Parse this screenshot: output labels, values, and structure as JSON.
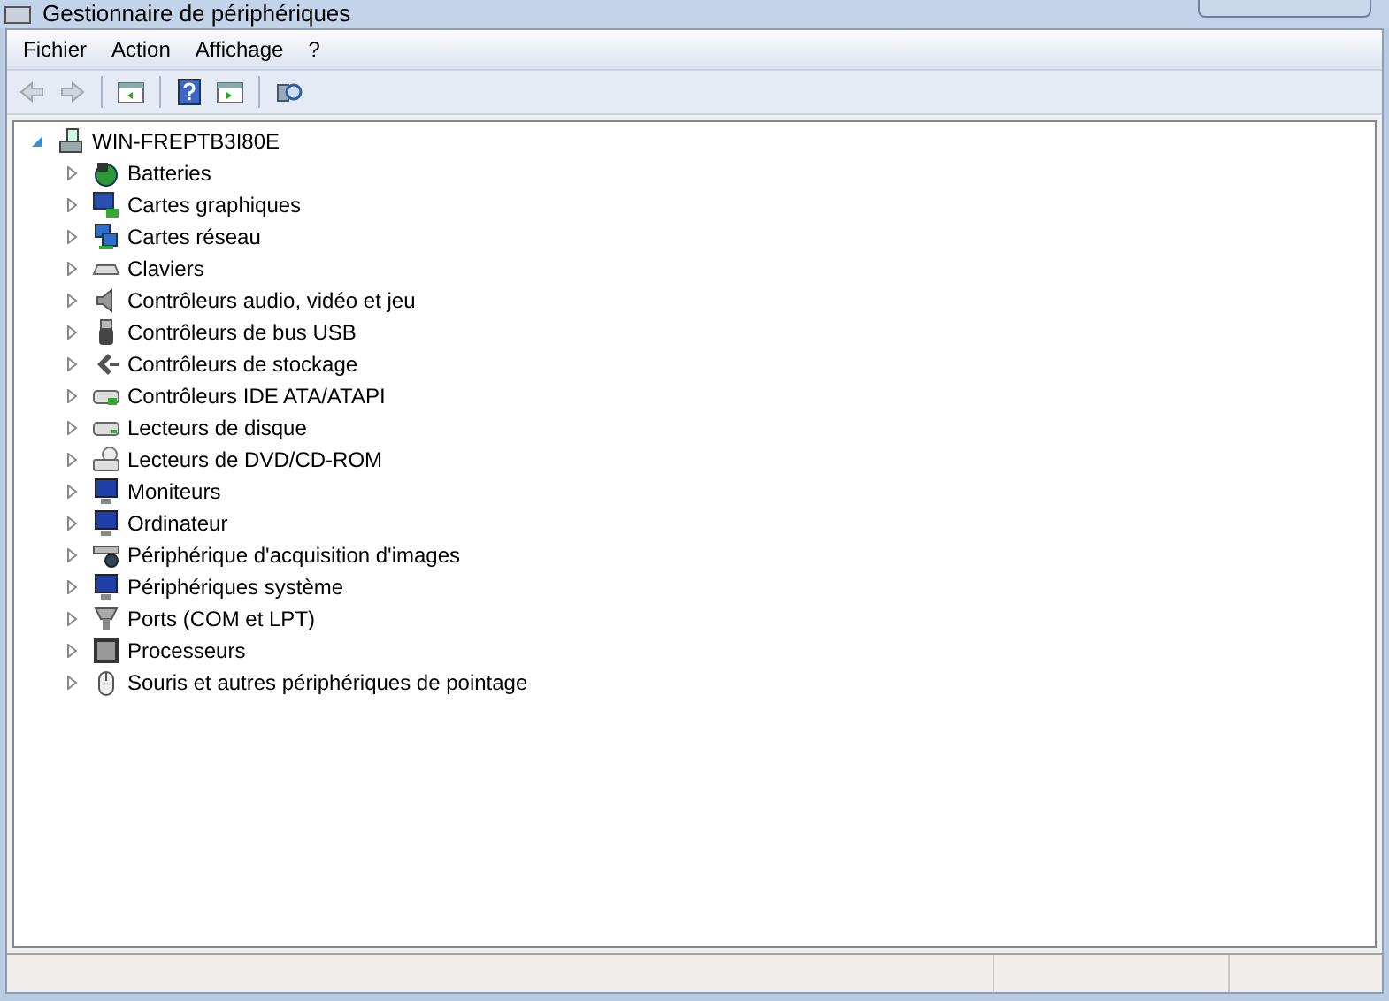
{
  "window": {
    "title": "Gestionnaire de périphériques"
  },
  "menu": [
    "Fichier",
    "Action",
    "Affichage",
    "?"
  ],
  "toolbar": [
    {
      "kind": "back",
      "disabled": true
    },
    {
      "kind": "forward",
      "disabled": true
    },
    {
      "kind": "sep"
    },
    {
      "kind": "console",
      "disabled": false
    },
    {
      "kind": "sep"
    },
    {
      "kind": "help",
      "disabled": false
    },
    {
      "kind": "panel",
      "disabled": false
    },
    {
      "kind": "sep"
    },
    {
      "kind": "scan",
      "disabled": false
    }
  ],
  "tree": {
    "label": "WIN-FREPTB3I80E",
    "kind": "computer",
    "expanded": true,
    "children": [
      {
        "label": "Batteries",
        "kind": "battery",
        "expanded": false
      },
      {
        "label": "Cartes graphiques",
        "kind": "display",
        "expanded": false
      },
      {
        "label": "Cartes réseau",
        "kind": "network",
        "expanded": false
      },
      {
        "label": "Claviers",
        "kind": "keyboard",
        "expanded": false
      },
      {
        "label": "Contrôleurs audio, vidéo et jeu",
        "kind": "speaker",
        "expanded": false
      },
      {
        "label": "Contrôleurs de bus USB",
        "kind": "usb",
        "expanded": false
      },
      {
        "label": "Contrôleurs de stockage",
        "kind": "storage",
        "expanded": false
      },
      {
        "label": "Contrôleurs IDE ATA/ATAPI",
        "kind": "card",
        "expanded": false
      },
      {
        "label": "Lecteurs de disque",
        "kind": "disk",
        "expanded": false
      },
      {
        "label": "Lecteurs de DVD/CD-ROM",
        "kind": "dvd",
        "expanded": false
      },
      {
        "label": "Moniteurs",
        "kind": "monitor",
        "expanded": false
      },
      {
        "label": "Ordinateur",
        "kind": "monitor",
        "expanded": false
      },
      {
        "label": "Périphérique d'acquisition d'images",
        "kind": "scanner",
        "expanded": false
      },
      {
        "label": "Périphériques système",
        "kind": "monitor",
        "expanded": false
      },
      {
        "label": "Ports (COM et LPT)",
        "kind": "port",
        "expanded": false
      },
      {
        "label": "Processeurs",
        "kind": "cpu",
        "expanded": false
      },
      {
        "label": "Souris et autres périphériques de pointage",
        "kind": "mouse",
        "expanded": false
      }
    ]
  }
}
